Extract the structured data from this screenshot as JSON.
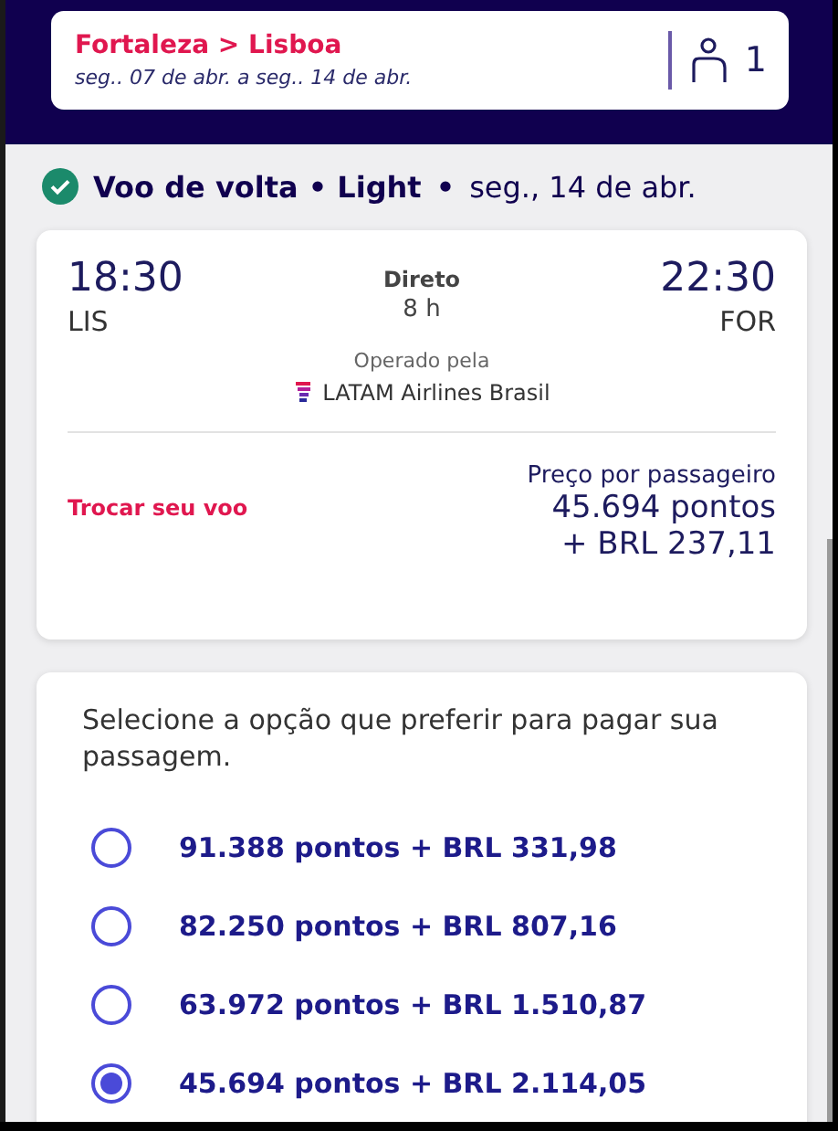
{
  "search_summary": {
    "route": "Fortaleza > Lisboa",
    "dates": "seg.. 07 de abr.  a seg.. 14 de abr.",
    "passengers": "1"
  },
  "leg_status": {
    "done": true,
    "title": "Voo de volta • Light",
    "separator": "•",
    "date": "seg., 14 de abr."
  },
  "flight": {
    "departure_time": "18:30",
    "departure_airport": "LIS",
    "type": "Direto",
    "duration": "8 h",
    "arrival_time": "22:30",
    "arrival_airport": "FOR",
    "operated_label": "Operado pela",
    "airline": "LATAM Airlines Brasil",
    "change_link": "Trocar seu voo",
    "price_label": "Preço por passageiro",
    "price_points": "45.694 pontos",
    "price_cash": "+ BRL 237,11"
  },
  "payment": {
    "prompt": "Selecione a opção que preferir para pagar sua passagem.",
    "options": [
      {
        "label": "91.388 pontos + BRL 331,98",
        "selected": false
      },
      {
        "label": "82.250 pontos + BRL 807,16",
        "selected": false
      },
      {
        "label": "63.972 pontos + BRL 1.510,87",
        "selected": false
      },
      {
        "label": "45.694 pontos + BRL 2.114,05",
        "selected": true
      }
    ]
  }
}
